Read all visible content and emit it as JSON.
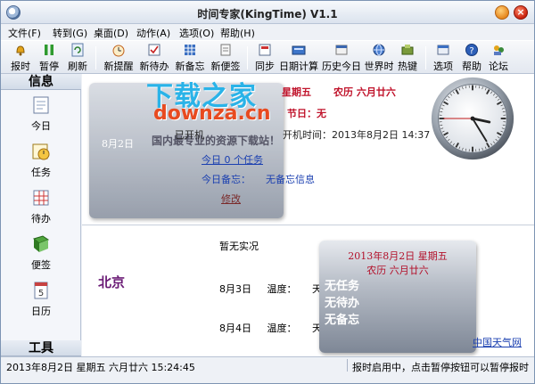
{
  "window": {
    "title": "时间专家(KingTime) V1.1"
  },
  "menu": [
    "文件(F)",
    "转到(G)",
    "桌面(D)",
    "动作(A)",
    "选项(O)",
    "帮助(H)"
  ],
  "toolbar": [
    {
      "label": "报时",
      "icon": "bell-icon"
    },
    {
      "label": "暂停",
      "icon": "pause-icon"
    },
    {
      "label": "刷新",
      "icon": "refresh-icon"
    },
    {
      "label": "新提醒",
      "icon": "alarm-clock-icon"
    },
    {
      "label": "新待办",
      "icon": "todo-icon"
    },
    {
      "label": "新备忘",
      "icon": "memo-grid-icon"
    },
    {
      "label": "新便签",
      "icon": "note-icon"
    },
    {
      "label": "同步",
      "icon": "sync-icon"
    },
    {
      "label": "日期计算",
      "icon": "calculator-icon"
    },
    {
      "label": "历史今日",
      "icon": "history-icon"
    },
    {
      "label": "世界时",
      "icon": "globe-icon"
    },
    {
      "label": "热键",
      "icon": "hotkey-icon"
    },
    {
      "label": "选项",
      "icon": "options-icon"
    },
    {
      "label": "帮助",
      "icon": "help-icon"
    },
    {
      "label": "论坛",
      "icon": "forum-icon"
    }
  ],
  "sidebar": {
    "info_header": "信息",
    "tools_header": "工具",
    "items": [
      {
        "label": "今日",
        "icon": "today-icon"
      },
      {
        "label": "任务",
        "icon": "task-icon"
      },
      {
        "label": "待办",
        "icon": "todo-grid-icon"
      },
      {
        "label": "便签",
        "icon": "note-book-icon"
      },
      {
        "label": "日历",
        "icon": "calendar-icon"
      }
    ]
  },
  "today": {
    "weekday": "星期五",
    "lunar": "农历  六月廿六",
    "holiday": "节日：无",
    "boot_label": "开机时间：",
    "boot_time": "2013年8月2日  14:37",
    "boot_duration_prefix": "已开机",
    "glass_date": "8月2日",
    "tasks": "今日 0 个任务",
    "memo_label": "今日备忘：",
    "memo_value": "无备忘信息",
    "edit": "修改"
  },
  "watermark": {
    "cn": "下载之家",
    "en": "downza.cn",
    "slogan": "国内最专业的资源下载站！"
  },
  "weather": {
    "city": "北京",
    "none": "暂无实况",
    "rows": [
      {
        "date": "8月3日",
        "temp_label": "温度：",
        "wx_label": "天气"
      },
      {
        "date": "8月4日",
        "temp_label": "温度：",
        "wx_label": "天气："
      }
    ],
    "link": "中国天气网"
  },
  "popup": {
    "line1": "2013年8月2日  星期五",
    "line2": "农历  六月廿六",
    "items": [
      "无任务",
      "无待办",
      "无备忘"
    ]
  },
  "status": {
    "left": "2013年8月2日  星期五   六月廿六   15:24:45",
    "right": "报时启用中，点击暂停按钮可以暂停报时"
  },
  "clock": {
    "hour": 3,
    "minute": 24,
    "second": 45
  }
}
